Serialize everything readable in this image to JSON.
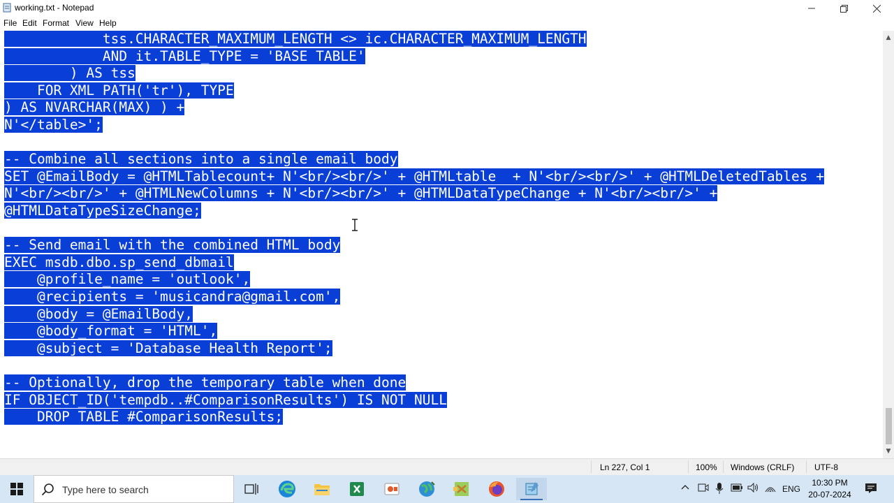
{
  "window": {
    "title": "working.txt - Notepad"
  },
  "menu": [
    "File",
    "Edit",
    "Format",
    "View",
    "Help"
  ],
  "editor": {
    "lines": [
      "            tss.CHARACTER_MAXIMUM_LENGTH <> ic.CHARACTER_MAXIMUM_LENGTH",
      "            AND it.TABLE_TYPE = 'BASE TABLE'",
      "        ) AS tss",
      "    FOR XML PATH('tr'), TYPE",
      ") AS NVARCHAR(MAX) ) +",
      "N'</table>';",
      "",
      "-- Combine all sections into a single email body",
      "SET @EmailBody = @HTMLTablecount+ N'<br/><br/>' + @HTMLtable  + N'<br/><br/>' + @HTMLDeletedTables +",
      "N'<br/><br/>' + @HTMLNewColumns + N'<br/><br/>' + @HTMLDataTypeChange + N'<br/><br/>' +",
      "@HTMLDataTypeSizeChange;",
      "",
      "-- Send email with the combined HTML body",
      "EXEC msdb.dbo.sp_send_dbmail",
      "    @profile_name = 'outlook',",
      "    @recipients = 'musicandra@gmail.com',",
      "    @body = @EmailBody,",
      "    @body_format = 'HTML',",
      "    @subject = 'Database Health Report';",
      "",
      "-- Optionally, drop the temporary table when done",
      "IF OBJECT_ID('tempdb..#ComparisonResults') IS NOT NULL",
      "    DROP TABLE #ComparisonResults;"
    ],
    "selection_color": "#0a3fd7"
  },
  "status": {
    "position": "Ln 227, Col 1",
    "zoom": "100%",
    "line_ending": "Windows (CRLF)",
    "encoding": "UTF-8"
  },
  "taskbar": {
    "search_placeholder": "Type here to search",
    "language": "ENG",
    "time": "10:30 PM",
    "date": "20-07-2024"
  }
}
